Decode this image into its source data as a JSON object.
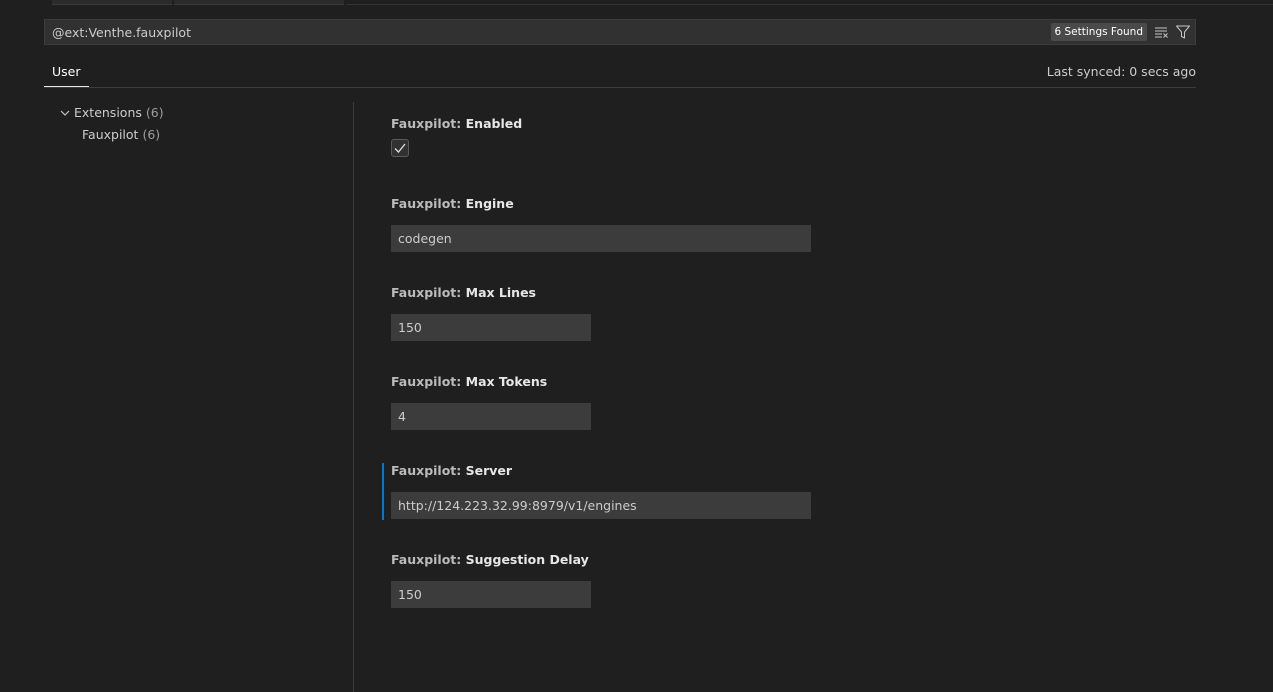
{
  "search": {
    "value": "@ext:Venthe.fauxpilot",
    "results_badge": "6 Settings Found",
    "clear_icon": "clear-filter-icon",
    "filter_icon": "filter-icon"
  },
  "tabs": {
    "user_label": "User",
    "last_synced": "Last synced: 0 secs ago"
  },
  "toc": {
    "extensions_label": "Extensions",
    "extensions_count": "(6)",
    "fauxpilot_label": "Fauxpilot",
    "fauxpilot_count": "(6)"
  },
  "settings": [
    {
      "category": "Fauxpilot: ",
      "name": "Enabled",
      "type": "checkbox",
      "checked": true
    },
    {
      "category": "Fauxpilot: ",
      "name": "Engine",
      "type": "text",
      "value": "codegen"
    },
    {
      "category": "Fauxpilot: ",
      "name": "Max Lines",
      "type": "number",
      "value": "150"
    },
    {
      "category": "Fauxpilot: ",
      "name": "Max Tokens",
      "type": "number",
      "value": "4"
    },
    {
      "category": "Fauxpilot: ",
      "name": "Server",
      "type": "text",
      "value": "http://124.223.32.99:8979/v1/engines"
    },
    {
      "category": "Fauxpilot: ",
      "name": "Suggestion Delay",
      "type": "number",
      "value": "150"
    }
  ],
  "colors": {
    "background": "#1f1f1f",
    "input_background": "#3c3c3c",
    "focus_accent": "#0078d4"
  }
}
